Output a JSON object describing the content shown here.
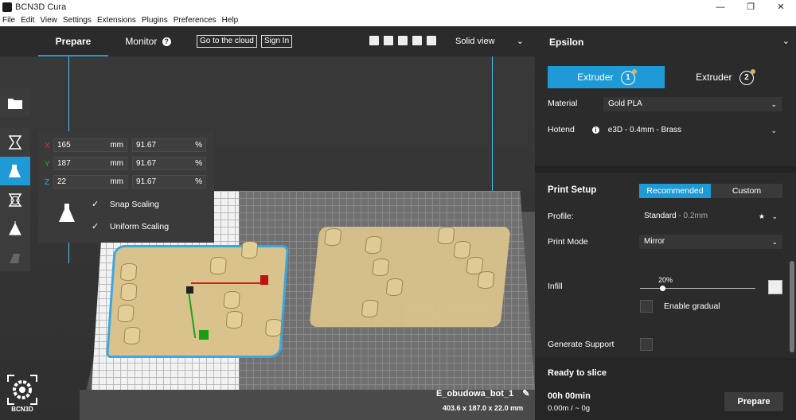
{
  "window": {
    "title": "BCN3D Cura",
    "minimize": "—",
    "restore": "❐",
    "close": "✕"
  },
  "menu": [
    "File",
    "Edit",
    "View",
    "Settings",
    "Extensions",
    "Plugins",
    "Preferences",
    "Help"
  ],
  "topbar": {
    "tab_prepare": "Prepare",
    "tab_monitor": "Monitor",
    "monitor_help": "?",
    "cloud_button": "Go to the cloud",
    "signin_button": "Sign In",
    "view_mode": "Solid view"
  },
  "scale": {
    "x_label": "X",
    "x_mm": "165",
    "x_pct": "91.67",
    "y_label": "Y",
    "y_mm": "187",
    "y_pct": "91.67",
    "z_label": "Z",
    "z_mm": "22",
    "z_pct": "91.67",
    "unit_mm": "mm",
    "unit_pct": "%",
    "snap_scaling": "Snap Scaling",
    "uniform_scaling": "Uniform Scaling",
    "check_mark": "✓"
  },
  "logo_text": "BCN3D",
  "job": {
    "name": "E_obudowa_bot_1",
    "dimensions": "403.6 x 187.0 x 22.0 mm"
  },
  "sidebar": {
    "printer": "Epsilon",
    "chevron": "⌄",
    "extruder1": "Extruder",
    "extruder1_num": "1",
    "extruder2": "Extruder",
    "extruder2_num": "2",
    "material_label": "Material",
    "material_value": "Gold PLA",
    "hotend_label": "Hotend",
    "hotend_value": "e3D - 0.4mm - Brass",
    "hotend_info": "i",
    "print_setup": "Print Setup",
    "recommended": "Recommended",
    "custom": "Custom",
    "profile_label": "Profile:",
    "profile_value": "Standard",
    "profile_layer": "- 0.2mm",
    "print_mode_label": "Print Mode",
    "print_mode_value": "Mirror",
    "infill_label": "Infill",
    "infill_value": "20%",
    "enable_gradual": "Enable gradual",
    "generate_support": "Generate Support",
    "ready": "Ready to slice",
    "time": "00h 00min",
    "material_usage": "0.00m / ~ 0g",
    "prepare_button": "Prepare"
  },
  "colors": {
    "accent": "#1e9bd7",
    "model": "#d9c28b",
    "panel": "#2b2b2b"
  }
}
